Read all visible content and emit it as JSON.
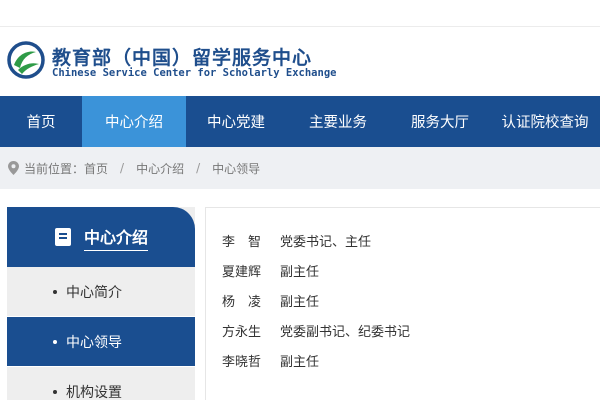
{
  "header": {
    "logo_cn": "教育部（中国）留学服务中心",
    "logo_en": "Chinese Service Center for Scholarly Exchange",
    "colors": {
      "brand": "#1a4e90",
      "active": "#3b93d9",
      "logo_green": "#2e9b47"
    }
  },
  "nav": {
    "items": [
      {
        "label": "首页"
      },
      {
        "label": "中心介绍"
      },
      {
        "label": "中心党建"
      },
      {
        "label": "主要业务"
      },
      {
        "label": "服务大厅"
      },
      {
        "label": "认证院校查询"
      }
    ]
  },
  "breadcrumb": {
    "prefix": "当前位置：",
    "items": [
      "首页",
      "中心介绍",
      "中心领导"
    ],
    "sep": "/"
  },
  "sidebar": {
    "title": "中心介绍",
    "items": [
      {
        "label": "中心简介"
      },
      {
        "label": "中心领导"
      },
      {
        "label": "机构设置"
      }
    ]
  },
  "leaders": [
    {
      "name": "李　智",
      "title": "党委书记、主任"
    },
    {
      "name": "夏建辉",
      "title": "副主任"
    },
    {
      "name": "杨　凌",
      "title": "副主任"
    },
    {
      "name": "方永生",
      "title": "党委副书记、纪委书记"
    },
    {
      "name": "李晓哲",
      "title": "副主任"
    }
  ]
}
